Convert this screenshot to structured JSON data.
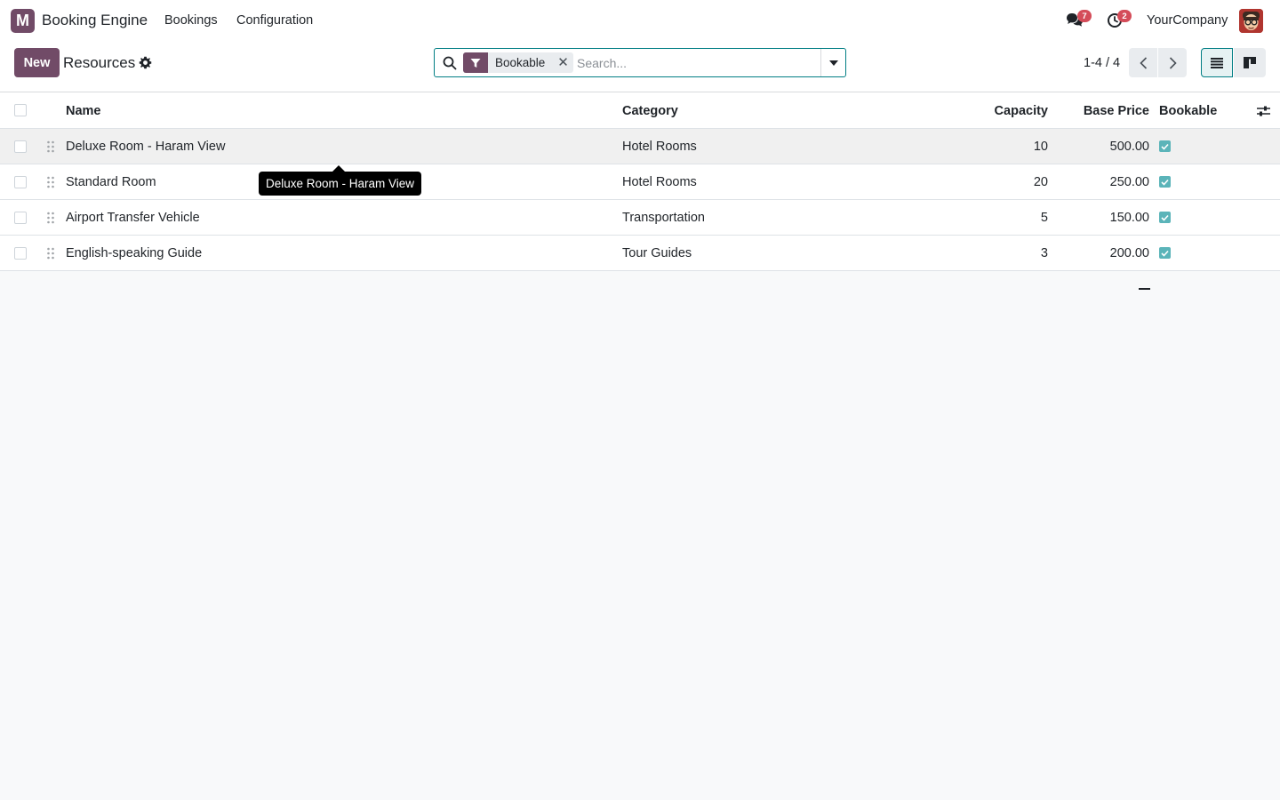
{
  "navbar": {
    "logo_letter": "M",
    "app_name": "Booking Engine",
    "menus": [
      "Bookings",
      "Configuration"
    ],
    "chat_icon": "chat-bubbles-icon",
    "chat_count": "7",
    "activity_icon": "clock-icon",
    "activity_count": "2",
    "company": "YourCompany",
    "accent_color": "#714b67"
  },
  "control_panel": {
    "new_label": "New",
    "title": "Resources",
    "gear_icon": "gear-icon",
    "search": {
      "facet_icon": "filter-icon",
      "facet_value": "Bookable",
      "placeholder": "Search..."
    },
    "pager": "1-4 / 4",
    "views": [
      "list-view-icon",
      "kanban-view-icon"
    ],
    "active_view": "list"
  },
  "table": {
    "columns": [
      "Name",
      "Category",
      "Capacity",
      "Base Price",
      "Bookable"
    ],
    "rows": [
      {
        "name": "Deluxe Room - Haram View",
        "category": "Hotel Rooms",
        "capacity": "10",
        "price": "500.00",
        "bookable": true
      },
      {
        "name": "Standard Room",
        "category": "Hotel Rooms",
        "capacity": "20",
        "price": "250.00",
        "bookable": true
      },
      {
        "name": "Airport Transfer Vehicle",
        "category": "Transportation",
        "capacity": "5",
        "price": "150.00",
        "bookable": true
      },
      {
        "name": "English-speaking Guide",
        "category": "Tour Guides",
        "capacity": "3",
        "price": "200.00",
        "bookable": true
      }
    ],
    "check_color": "#5bb4b9"
  },
  "tooltip": {
    "text": "Deluxe Room - Haram View"
  }
}
